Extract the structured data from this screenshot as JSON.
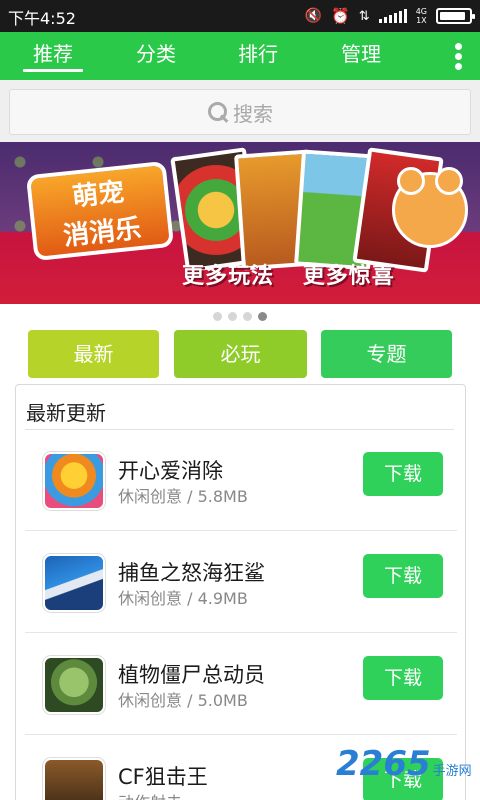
{
  "status_bar": {
    "time": "下午4:52",
    "network": "4G",
    "network_sub": "1X",
    "battery_level": 0.9
  },
  "nav": {
    "tabs": [
      {
        "label": "推荐",
        "active": true
      },
      {
        "label": "分类",
        "active": false
      },
      {
        "label": "排行",
        "active": false
      },
      {
        "label": "管理",
        "active": false
      }
    ],
    "accent_color": "#2bc94a"
  },
  "search": {
    "placeholder": "搜索"
  },
  "banner": {
    "logo_line1": "萌宠",
    "logo_line2": "消消乐",
    "slogan_1": "更多玩法",
    "slogan_2": "更多惊喜",
    "page_count": 4,
    "current_page": 4
  },
  "categories": [
    {
      "label": "最新",
      "color": "#b6d32a"
    },
    {
      "label": "必玩",
      "color": "#8fcc2a"
    },
    {
      "label": "专题",
      "color": "#36cc5b"
    }
  ],
  "latest": {
    "title": "最新更新",
    "items": [
      {
        "name": "开心爱消除",
        "meta": "休闲创意 / 5.8MB",
        "button": "下载"
      },
      {
        "name": "捕鱼之怒海狂鲨",
        "meta": "休闲创意 / 4.9MB",
        "button": "下载"
      },
      {
        "name": "植物僵尸总动员",
        "meta": "休闲创意 / 5.0MB",
        "button": "下载"
      },
      {
        "name": "CF狙击王",
        "meta": "动作射击",
        "button": "下载"
      }
    ]
  },
  "watermark": {
    "number": "2265",
    "text": "手游网"
  }
}
